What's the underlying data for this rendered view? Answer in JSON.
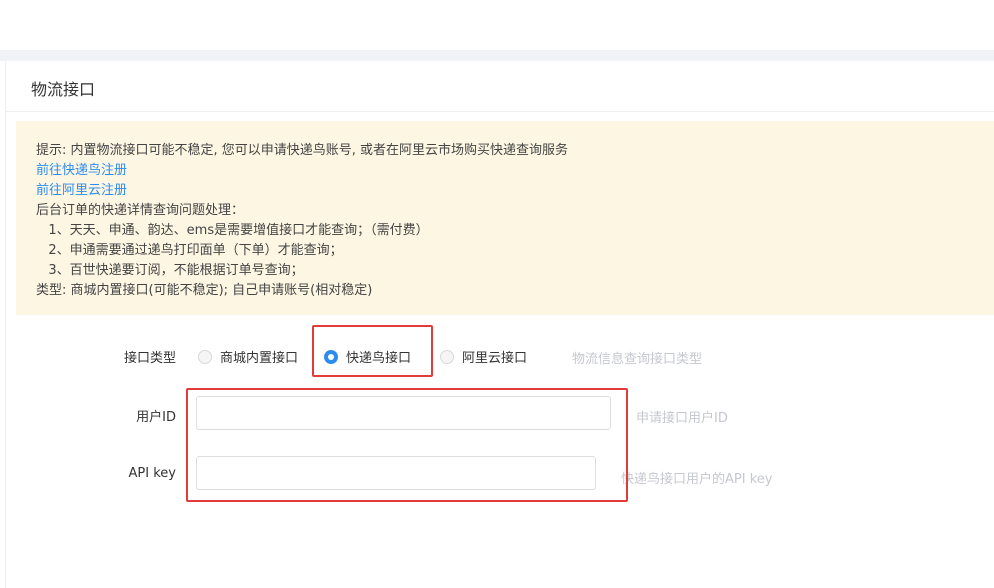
{
  "panel": {
    "title": "物流接口"
  },
  "notice": {
    "intro": "提示: 内置物流接口可能不稳定, 您可以申请快递鸟账号, 或者在阿里云市场购买快递查询服务",
    "link_kdniao": "前往快递鸟注册",
    "link_aliyun": "前往阿里云注册",
    "section": "后台订单的快递详情查询问题处理：",
    "item1": "   1、天天、申通、韵达、ems是需要增值接口才能查询；（需付费）",
    "item2": "   2、申通需要通过递鸟打印面单（下单）才能查询；",
    "item3": "   3、百世快递要订阅，不能根据订单号查询；",
    "types": "类型: 商城内置接口(可能不稳定); 自己申请账号(相对稳定)"
  },
  "form": {
    "type_label": "接口类型",
    "options": [
      {
        "label": "商城内置接口",
        "checked": false
      },
      {
        "label": "快递鸟接口",
        "checked": true
      },
      {
        "label": "阿里云接口",
        "checked": false
      }
    ],
    "type_hint": "物流信息查询接口类型",
    "user_id_label": "用户ID",
    "user_id_value": "",
    "user_id_hint": "申请接口用户ID",
    "api_key_label": "API key",
    "api_key_value": "",
    "api_key_hint": "快递鸟接口用户的API key"
  },
  "colors": {
    "accent": "#2d8cf0",
    "notice_bg": "#fdf6e3",
    "highlight": "#e23b3b"
  }
}
